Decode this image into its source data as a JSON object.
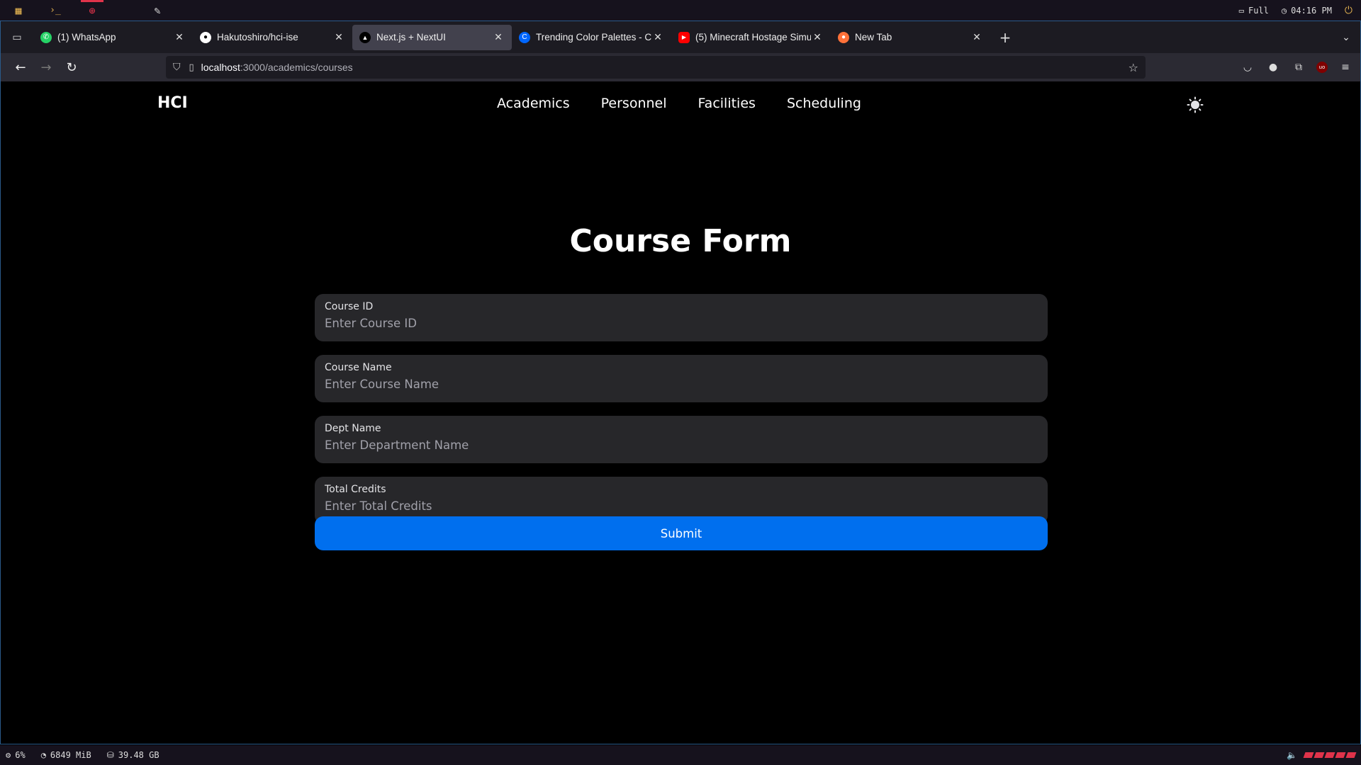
{
  "system_bar": {
    "workspaces": [
      {
        "icon": "grid-icon",
        "glyph": "▦",
        "color": "#e0b050"
      },
      {
        "icon": "terminal-icon",
        "glyph": "›_",
        "color": "#e0b050"
      },
      {
        "icon": "globe-icon",
        "glyph": "⊕",
        "color": "#e0334a"
      },
      {
        "icon": "blank",
        "glyph": "",
        "color": "#ddd"
      },
      {
        "icon": "feather-icon",
        "glyph": "✎",
        "color": "#ddd"
      }
    ],
    "battery_label": "Full",
    "clock": "04:16 PM"
  },
  "browser": {
    "tabs": [
      {
        "title": "(1) WhatsApp",
        "favicon": "whatsapp-icon",
        "favicon_color": "#25d366",
        "active": false
      },
      {
        "title": "Hakutoshiro/hci-ise",
        "favicon": "github-icon",
        "favicon_color": "#ffffff",
        "active": false
      },
      {
        "title": "Next.js + NextUI",
        "favicon": "nextjs-icon",
        "favicon_color": "#000000",
        "active": true
      },
      {
        "title": "Trending Color Palettes - C",
        "favicon": "coolors-icon",
        "favicon_color": "#0066ff",
        "active": false
      },
      {
        "title": "(5) Minecraft Hostage Simu",
        "favicon": "youtube-icon",
        "favicon_color": "#ff0000",
        "active": false
      },
      {
        "title": "New Tab",
        "favicon": "firefox-icon",
        "favicon_color": "#ff7139",
        "active": false
      }
    ],
    "url_host": "localhost",
    "url_path": ":3000/academics/courses"
  },
  "site": {
    "logo": "HCI",
    "nav": [
      "Academics",
      "Personnel",
      "Facilities",
      "Scheduling"
    ]
  },
  "form": {
    "title": "Course Form",
    "fields": [
      {
        "label": "Course ID",
        "placeholder": "Enter Course ID",
        "value": ""
      },
      {
        "label": "Course Name",
        "placeholder": "Enter Course Name",
        "value": ""
      },
      {
        "label": "Dept Name",
        "placeholder": "Enter Department Name",
        "value": ""
      },
      {
        "label": "Total Credits",
        "placeholder": "Enter Total Credits",
        "value": ""
      }
    ],
    "submit_label": "Submit"
  },
  "bottom_bar": {
    "cpu": "6%",
    "memory": "6849 MiB",
    "disk": "39.48 GB"
  },
  "colors": {
    "accent": "#006fee",
    "field_bg": "#27272a",
    "bar_accent": "#e0334a"
  }
}
